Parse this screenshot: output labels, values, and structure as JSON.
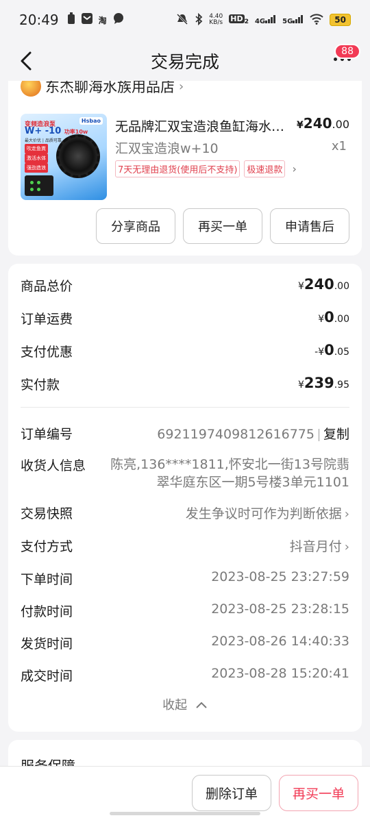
{
  "status_bar": {
    "time": "20:49",
    "left_icons": [
      "battery-saver-icon",
      "mail-icon",
      "taobao-icon",
      "chat-icon"
    ],
    "network_speed_value": "4.40",
    "network_speed_unit": "KB/s",
    "hd": "HD",
    "hd_sub": "2",
    "net_4g": "4G",
    "net_5g": "5G",
    "battery": "50"
  },
  "nav": {
    "title": "交易完成",
    "badge": "88"
  },
  "shop": {
    "name": "东杰聊海水族用品店"
  },
  "product": {
    "image_line1": "变频造浪泵",
    "image_line2": "W+ -10",
    "image_power": "功率10w",
    "image_line3": "最大价优 | 品质可靠",
    "image_brand": "Hsbao",
    "image_tags": [
      "吹走鱼粪",
      "激活水体",
      "强劲造浪"
    ],
    "title": "无品牌汇双宝造浪鱼缸海水缸造浪泵",
    "price_symbol": "¥",
    "price_int": "240",
    "price_dec": ".00",
    "spec": "汇双宝造浪w+10",
    "qty": "x1",
    "tags": [
      "7天无理由退货(使用后不支持)",
      "极速退款"
    ]
  },
  "product_actions": [
    "分享商品",
    "再买一单",
    "申请售后"
  ],
  "summary": {
    "goods_total_label": "商品总价",
    "goods_total_int": "240",
    "goods_total_dec": ".00",
    "shipping_label": "订单运费",
    "shipping_int": "0",
    "shipping_dec": ".00",
    "discount_label": "支付优惠",
    "discount_prefix": "-¥",
    "discount_int": "0",
    "discount_dec": ".05",
    "paid_label": "实付款",
    "paid_int": "239",
    "paid_dec": ".95",
    "currency": "¥"
  },
  "details": {
    "order_no_label": "订单编号",
    "order_no": "6921197409812616775",
    "copy": "复制",
    "receiver_label": "收货人信息",
    "receiver": "陈亮,136****1811,怀安北一街13号院翡翠华庭东区一期5号楼3单元1101",
    "snapshot_label": "交易快照",
    "snapshot": "发生争议时可作为判断依据",
    "pay_method_label": "支付方式",
    "pay_method": "抖音月付",
    "order_time_label": "下单时间",
    "order_time": "2023-08-25 23:27:59",
    "pay_time_label": "付款时间",
    "pay_time": "2023-08-25 23:28:15",
    "ship_time_label": "发货时间",
    "ship_time": "2023-08-26 14:40:33",
    "deal_time_label": "成交时间",
    "deal_time": "2023-08-28 15:20:41",
    "collapse": "收起"
  },
  "service": {
    "title": "服务保障"
  },
  "bottom": {
    "delete": "删除订单",
    "rebuy": "再买一单"
  }
}
